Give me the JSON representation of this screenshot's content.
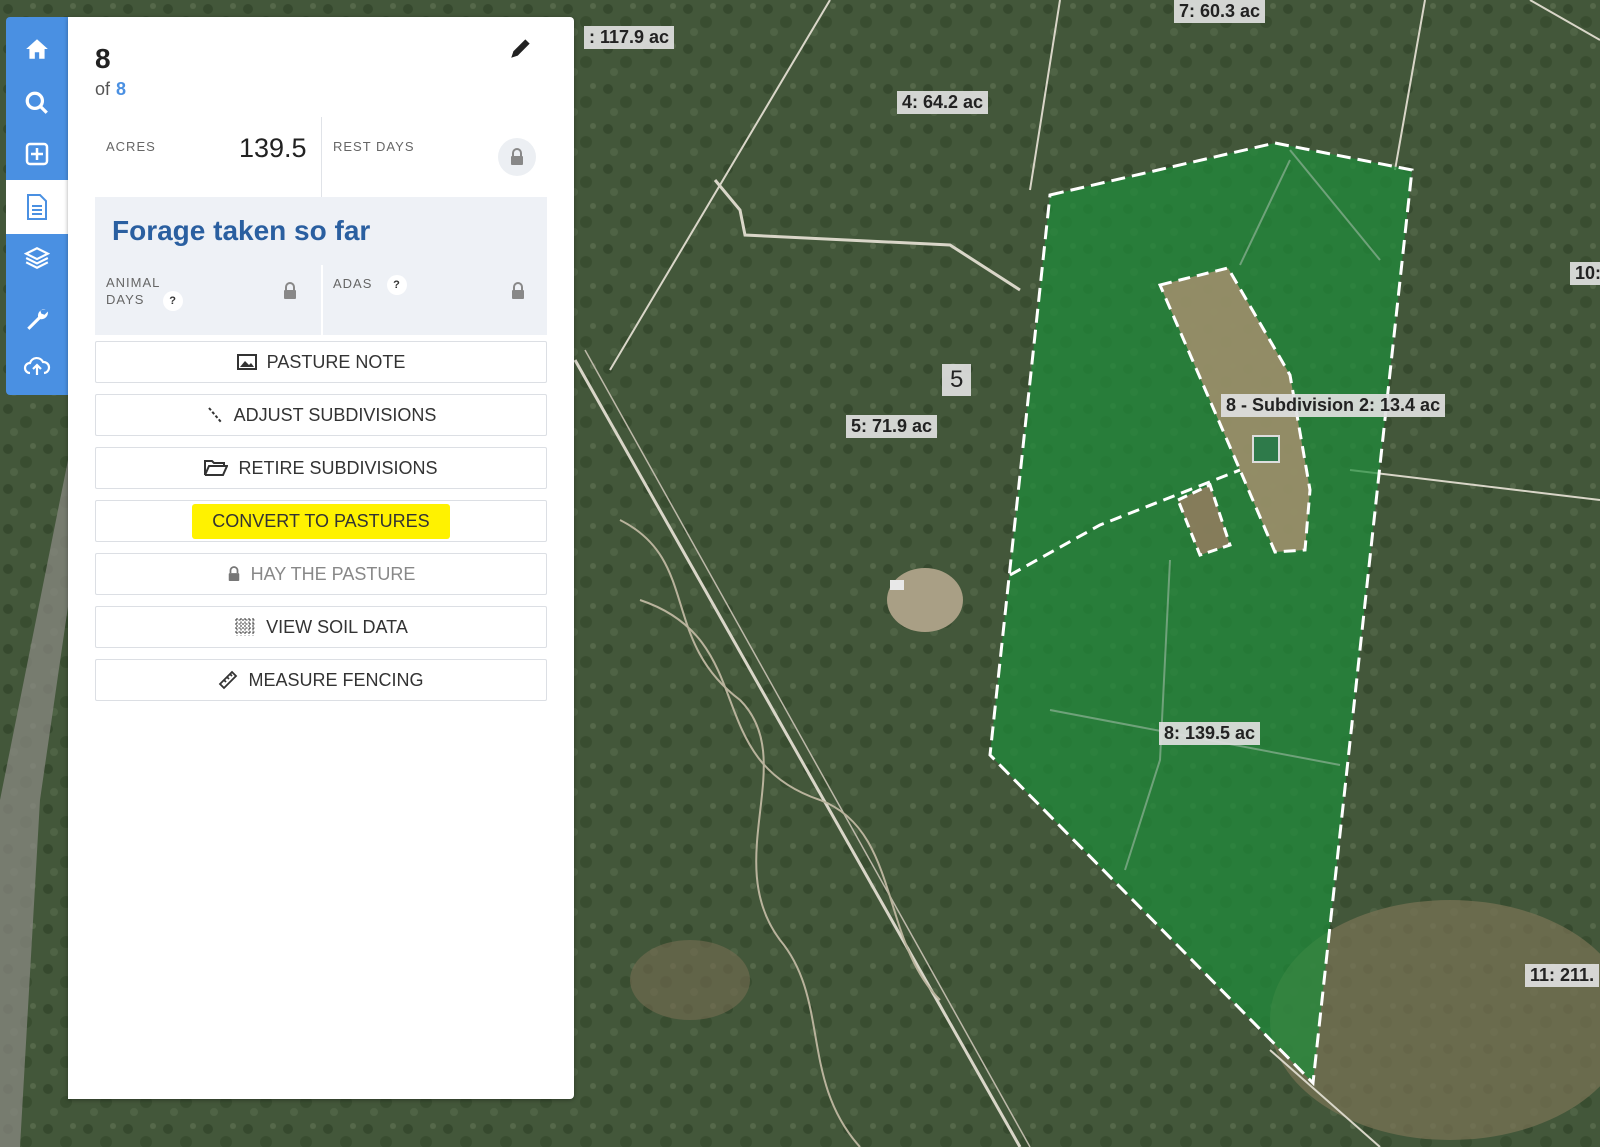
{
  "pasture": {
    "number": "8",
    "of_label": "of",
    "total": "8"
  },
  "stats": {
    "acres_label": "ACRES",
    "acres_value": "139.5",
    "rest_days_label": "REST DAYS"
  },
  "forage": {
    "title": "Forage taken so far",
    "animal_days_label_1": "ANIMAL",
    "animal_days_label_2": "DAYS",
    "adas_label": "ADAS",
    "help": "?"
  },
  "actions": [
    {
      "label": "PASTURE NOTE",
      "icon": "image-icon",
      "enabled": true
    },
    {
      "label": "ADJUST SUBDIVISIONS",
      "icon": "line-icon",
      "enabled": true
    },
    {
      "label": "RETIRE SUBDIVISIONS",
      "icon": "folder-open-icon",
      "enabled": true
    },
    {
      "label": "CONVERT TO PASTURES",
      "icon": "",
      "enabled": true,
      "highlight": "#fff200"
    },
    {
      "label": "HAY THE PASTURE",
      "icon": "lock-icon",
      "enabled": false
    },
    {
      "label": "VIEW SOIL DATA",
      "icon": "grid-icon",
      "enabled": true
    },
    {
      "label": "MEASURE FENCING",
      "icon": "ruler-icon",
      "enabled": true
    }
  ],
  "toolbar": [
    "home-icon",
    "search-icon",
    "add-box-icon",
    "document-icon",
    "layers-icon",
    "wrench-icon",
    "cloud-upload-icon"
  ],
  "map_labels": {
    "l117": ": 117.9 ac",
    "l7": "7: 60.3 ac",
    "l4": "4: 64.2 ac",
    "l5num": "5",
    "l5": "5: 71.9 ac",
    "lsub": "8 - Subdivision 2: 13.4 ac",
    "l8": "8: 139.5 ac",
    "l10": "10:",
    "l11": "11: 211."
  },
  "colors": {
    "accent": "#4a90e2",
    "pasture_fill": "#1e8c3a",
    "highlight": "#fff200",
    "forage_title": "#2a5fa0"
  }
}
